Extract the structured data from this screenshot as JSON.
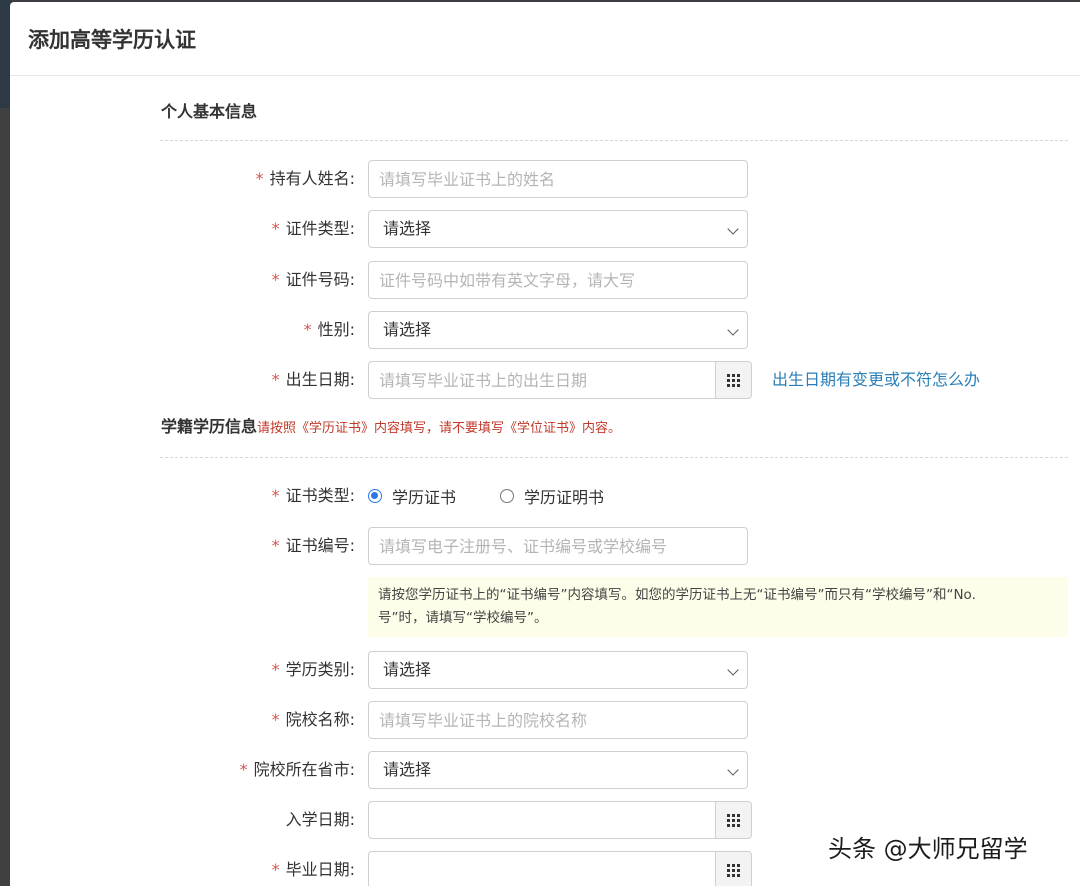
{
  "dialog": {
    "title": "添加高等学历认证"
  },
  "personal": {
    "title": "个人基本信息",
    "fields": {
      "holder_name": {
        "label": "持有人姓名:",
        "placeholder": "请填写毕业证书上的姓名"
      },
      "id_type": {
        "label": "证件类型:",
        "value": "请选择"
      },
      "id_number": {
        "label": "证件号码:",
        "placeholder": "证件号码中如带有英文字母，请大写"
      },
      "gender": {
        "label": "性别:",
        "value": "请选择"
      },
      "birth_date": {
        "label": "出生日期:",
        "placeholder": "请填写毕业证书上的出生日期",
        "help_link": "出生日期有变更或不符怎么办"
      }
    }
  },
  "education": {
    "title": "学籍学历信息",
    "note": "请按照《学历证书》内容填写，请不要填写《学位证书》内容。",
    "fields": {
      "cert_type": {
        "label": "证书类型:",
        "options": [
          "学历证书",
          "学历证明书"
        ],
        "selected": "学历证书"
      },
      "cert_number": {
        "label": "证书编号:",
        "placeholder": "请填写电子注册号、证书编号或学校编号",
        "hint_line1": "请按您学历证书上的“证书编号”内容填写。如您的学历证书上无“证书编号”而只有“学校编号”和“No.",
        "hint_line2": "号”时，请填写“学校编号”。"
      },
      "edu_category": {
        "label": "学历类别:",
        "value": "请选择"
      },
      "school_name": {
        "label": "院校名称:",
        "placeholder": "请填写毕业证书上的院校名称"
      },
      "school_province": {
        "label": "院校所在省市:",
        "value": "请选择"
      },
      "enroll_date": {
        "label": "入学日期:",
        "placeholder": ""
      },
      "grad_date": {
        "label": "毕业日期:",
        "placeholder": ""
      }
    }
  },
  "required_mark": "*",
  "watermark": "头条 @大师兄留学"
}
